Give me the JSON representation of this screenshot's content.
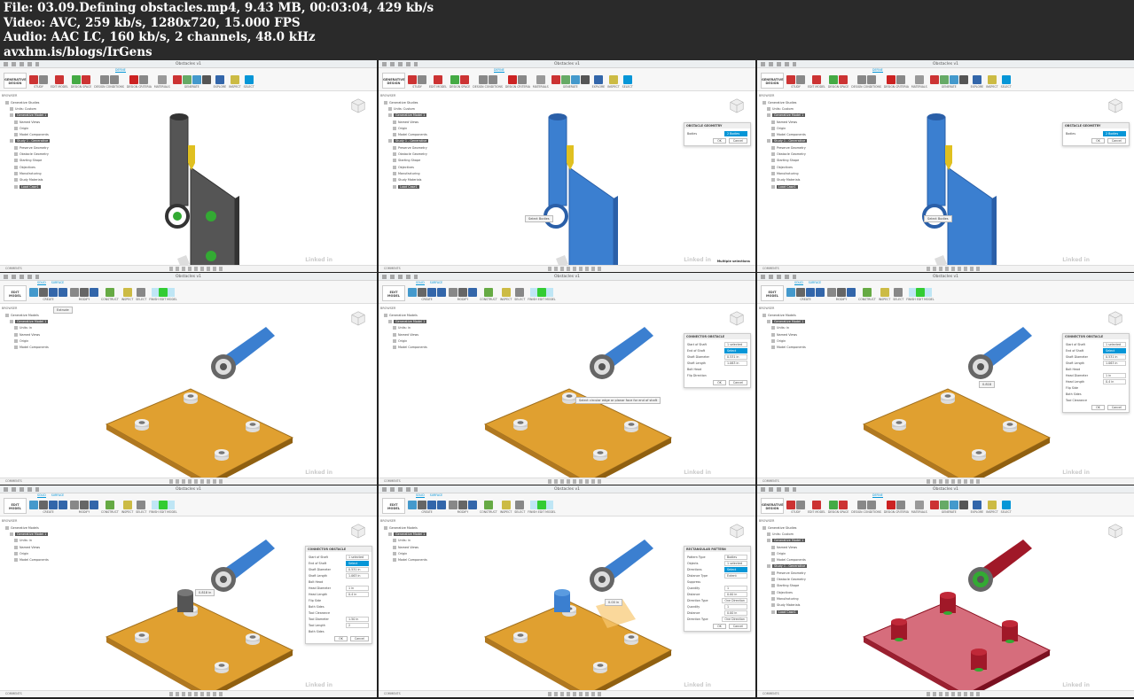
{
  "header": {
    "line1": "File: 03.09.Defining obstacles.mp4, 9.43 MB, 00:03:04, 429 kb/s",
    "line2": "Video: AVC, 259 kb/s, 1280x720, 15.000 FPS",
    "line3": "Audio: AAC LC, 160 kb/s, 2 channels, 48.0 kHz",
    "line4": "avxhm.is/blogs/IrGens"
  },
  "common": {
    "doc_title": "Obstacles v1",
    "browser": "BROWSER",
    "comments": "COMMENTS",
    "watermark": "Linked in"
  },
  "gd_toolbar": {
    "workspace": "GENERATIVE DESIGN",
    "tab": "DEFINE",
    "groups": [
      "STUDY",
      "EDIT MODEL",
      "DESIGN SPACE",
      "DESIGN CONDITIONS",
      "DESIGN CRITERIA",
      "MATERIALS",
      "GENERATE",
      "EXPLORE",
      "INSPECT",
      "SELECT"
    ]
  },
  "em_toolbar": {
    "workspace": "EDIT MODEL",
    "tabs": [
      "SOLID",
      "SURFACE"
    ],
    "groups": [
      "CREATE",
      "MODIFY",
      "CONSTRUCT",
      "INSPECT",
      "SELECT",
      "FINISH EDIT MODEL"
    ]
  },
  "gd_tree": [
    "Generative Studies",
    "Units: Custom",
    "Generative Model 1",
    "Named Views",
    "Origin",
    "Model Components",
    "Study 1 - Generative",
    "Preserve Geometry",
    "Obstacle Geometry",
    "Starting Shape",
    "Objectives",
    "Manufacturing",
    "Study Materials",
    "Load Case1"
  ],
  "em_tree": [
    "Generative Models",
    "Generative Model 1",
    "Units: in",
    "Named Views",
    "Origin",
    "Model Components"
  ],
  "colors": {
    "accent": "#0696d7",
    "plate": "#e0a030",
    "part_blue": "#3b7fd0",
    "obstacle_red": "#b0202c"
  },
  "frames": [
    {
      "mode": "gd",
      "scene": "bracket-gray"
    },
    {
      "mode": "gd",
      "scene": "bracket-blue",
      "tooltip": "Select Bodies",
      "status": "Multiple selections",
      "panel": {
        "title": "OBSTACLE GEOMETRY",
        "rows": [
          [
            "Bodies",
            "2 Bodies"
          ]
        ],
        "ok": "OK",
        "cancel": "Cancel"
      }
    },
    {
      "mode": "gd",
      "scene": "bracket-blue",
      "tooltip": "Select Bodies",
      "panel": {
        "title": "OBSTACLE GEOMETRY",
        "rows": [
          [
            "Bodies",
            "2 Bodies"
          ]
        ],
        "ok": "OK",
        "cancel": "Cancel"
      }
    },
    {
      "mode": "em",
      "scene": "plate",
      "tooltip": "Extrude"
    },
    {
      "mode": "em",
      "scene": "plate",
      "tooltip": "Select circular edge or planar face for end of shaft",
      "panel": {
        "title": "CONNECTOR OBSTACLE",
        "rows": [
          [
            "Start of Shaft",
            "1 selected"
          ],
          [
            "End of Shaft",
            "Select"
          ],
          [
            "Shaft Diameter",
            "0.531 in"
          ],
          [
            "Shaft Length",
            "1.063 in"
          ],
          [
            "Bolt Head",
            ""
          ],
          [
            "Flip Direction",
            ""
          ]
        ],
        "ok": "OK",
        "cancel": "Cancel"
      }
    },
    {
      "mode": "em",
      "scene": "plate",
      "tooltip": "0.818",
      "panel": {
        "title": "CONNECTOR OBSTACLE",
        "rows": [
          [
            "Start of Shaft",
            "1 selected"
          ],
          [
            "End of Shaft",
            "Select"
          ],
          [
            "Shaft Diameter",
            "0.531 in"
          ],
          [
            "Shaft Length",
            "1.063 in"
          ],
          [
            "Bolt Head",
            ""
          ],
          [
            "Head Diameter",
            "1 in"
          ],
          [
            "Head Length",
            "0.4 in"
          ],
          [
            "Flip Side",
            ""
          ],
          [
            "Both Sides",
            ""
          ],
          [
            "Tool Clearance",
            ""
          ]
        ],
        "ok": "OK",
        "cancel": "Cancel"
      }
    },
    {
      "mode": "em",
      "scene": "plate-cyl",
      "tooltip": "0.818 in",
      "panel": {
        "title": "CONNECTOR OBSTACLE",
        "rows": [
          [
            "Start of Shaft",
            "1 selected"
          ],
          [
            "End of Shaft",
            "Select"
          ],
          [
            "Shaft Diameter",
            "0.531 in"
          ],
          [
            "Shaft Length",
            "1.063 in"
          ],
          [
            "Bolt Head",
            ""
          ],
          [
            "Head Diameter",
            "1 in"
          ],
          [
            "Head Length",
            "0.4 in"
          ],
          [
            "Flip Side",
            ""
          ],
          [
            "Both Sides",
            ""
          ],
          [
            "Tool Clearance",
            ""
          ],
          [
            "Tool Diameter",
            "1.50 in"
          ],
          [
            "Tool Length",
            "2"
          ],
          [
            "Both Sides",
            ""
          ]
        ],
        "ok": "OK",
        "cancel": "Cancel"
      }
    },
    {
      "mode": "em",
      "scene": "plate-pattern",
      "tooltip": "0.00 in",
      "panel": {
        "title": "RECTANGULAR PATTERN",
        "rows": [
          [
            "Pattern Type",
            "Bodies"
          ],
          [
            "Objects",
            "1 selected"
          ],
          [
            "Directions",
            "Select"
          ],
          [
            "Distance Type",
            "Extent"
          ],
          [
            "Suppress",
            ""
          ],
          [
            "Quantity",
            "1"
          ],
          [
            "Distance",
            "0.00 in"
          ],
          [
            "Direction Type",
            "One Direction"
          ],
          [
            "Quantity",
            "1"
          ],
          [
            "Distance",
            "0.00 in"
          ],
          [
            "Direction Type",
            "One Direction"
          ]
        ],
        "ok": "OK",
        "cancel": "Cancel"
      }
    },
    {
      "mode": "gd",
      "scene": "plate-red"
    }
  ]
}
